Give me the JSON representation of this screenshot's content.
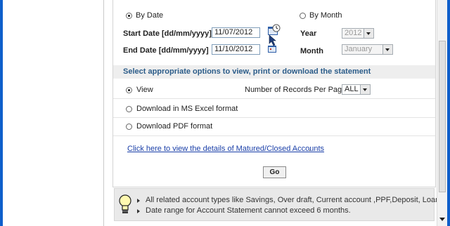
{
  "date_filter": {
    "by_date_label": "By Date",
    "by_month_label": "By Month",
    "start_label": "Start Date [dd/mm/yyyy]",
    "start_value": "11/07/2012",
    "end_label": "End Date  [dd/mm/yyyy]",
    "end_value": "11/10/2012",
    "year_label": "Year",
    "year_value": "2012",
    "month_label": "Month",
    "month_value": "January"
  },
  "options": {
    "section_title": "Select appropriate options to view, print or download the statement",
    "view_label": "View",
    "records_label": "Number of Records Per Page",
    "records_value": "ALL",
    "excel_label": "Download in MS Excel format",
    "pdf_label": "Download PDF format",
    "link_text": "Click here to view the details of Matured/Closed Accounts",
    "link_suffix": ".",
    "go_label": "Go"
  },
  "notes": [
    "All related account types like Savings, Over draft, Current account ,PPF,Deposit, Loan",
    "Date range for Account Statement cannot exceed 6 months."
  ],
  "icons": {
    "calendar": "calendar-icon",
    "bulb": "lightbulb-icon"
  }
}
